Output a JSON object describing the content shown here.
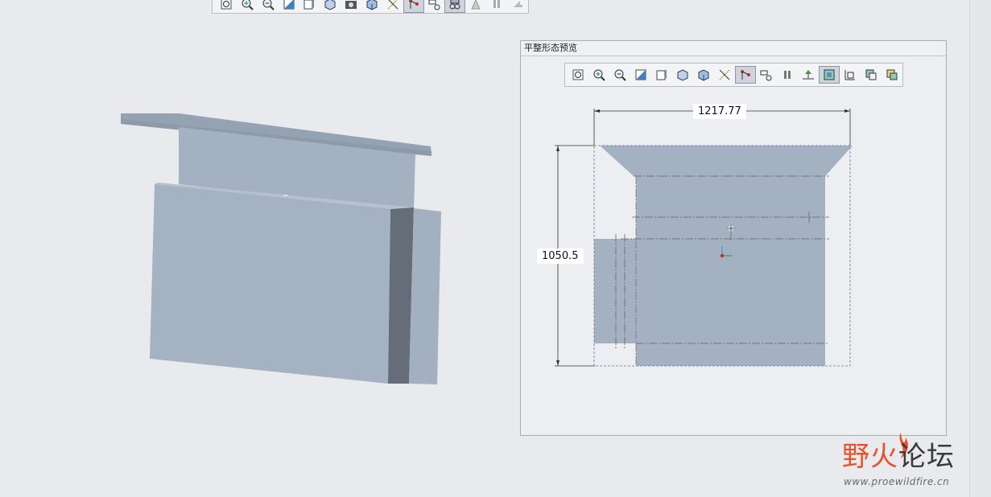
{
  "preview_panel": {
    "title": "平整形态预览"
  },
  "dimensions": {
    "width_value": "1217.77",
    "height_value": "1050.5"
  },
  "top_toolbar": {
    "icons": [
      "zoom-fit-icon",
      "zoom-in-icon",
      "zoom-out-icon",
      "repaint-icon",
      "saved-views-icon",
      "view-manager-icon",
      "snapshot-icon",
      "display-style-icon",
      "datum-display-icon",
      "spin-center-icon",
      "annotation-display-icon",
      "appearance-icon",
      "model-tree-icon",
      "pause-icon",
      "redo-icon"
    ],
    "active": [
      9
    ]
  },
  "preview_toolbar": {
    "icons": [
      "zoom-fit-icon",
      "zoom-in-icon",
      "zoom-out-icon",
      "repaint-icon",
      "saved-views-icon",
      "view-manager-icon",
      "display-style-icon",
      "datum-display-icon",
      "spin-center-icon",
      "annotation-display-icon",
      "pause-icon",
      "flatten-icon",
      "layer-icon",
      "dimension-icon",
      "copy-icon",
      "paste-icon"
    ],
    "active": [
      8,
      12
    ]
  },
  "colors": {
    "part_face": "#a4b1c0",
    "part_side": "#646d78",
    "background": "#e9eaee"
  },
  "watermark": {
    "ye": "野",
    "huo": "火",
    "lt": "论坛",
    "url": "www.proewildfire.cn"
  }
}
